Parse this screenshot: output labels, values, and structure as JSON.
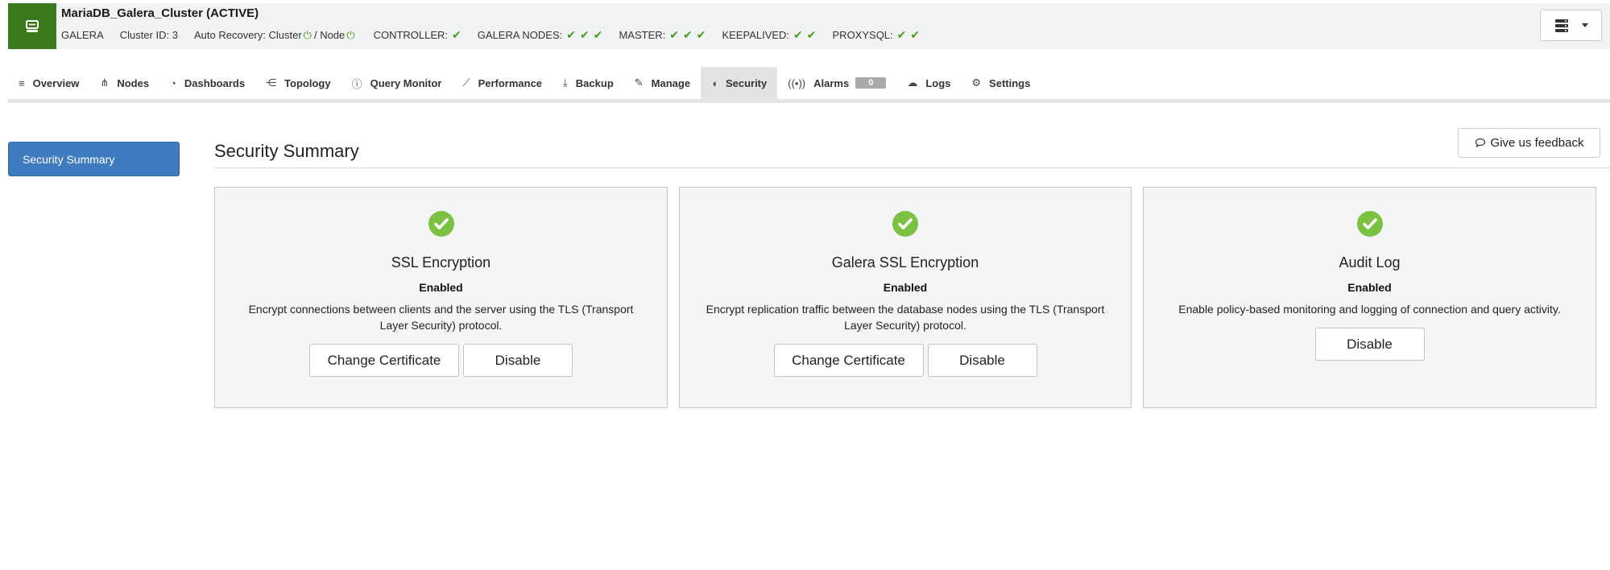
{
  "header": {
    "title": "MariaDB_Galera_Cluster (ACTIVE)",
    "type": "GALERA",
    "cluster_id": "Cluster ID: 3",
    "auto_recovery_label": "Auto Recovery: Cluster",
    "auto_recovery_node": "/ Node",
    "controller": "CONTROLLER:",
    "galera_nodes": "GALERA NODES:",
    "master": "MASTER:",
    "keepalived": "KEEPALIVED:",
    "proxysql": "PROXYSQL:",
    "check": "✔",
    "power": "⏻",
    "status_color": "#4a9c1f",
    "brand_color": "#3b7a1f"
  },
  "tabs": [
    {
      "label": "Overview",
      "icon": "list-icon",
      "glyph": "≡"
    },
    {
      "label": "Nodes",
      "icon": "nodes-icon",
      "glyph": "⋔"
    },
    {
      "label": "Dashboards",
      "icon": "dashboard-icon",
      "glyph": "◔"
    },
    {
      "label": "Topology",
      "icon": "topology-icon",
      "glyph": "⋲"
    },
    {
      "label": "Query Monitor",
      "icon": "query-monitor-icon",
      "glyph": "ⓘ"
    },
    {
      "label": "Performance",
      "icon": "performance-icon",
      "glyph": "⟋"
    },
    {
      "label": "Backup",
      "icon": "backup-icon",
      "glyph": "⤓"
    },
    {
      "label": "Manage",
      "icon": "wrench-icon",
      "glyph": "✎"
    },
    {
      "label": "Security",
      "icon": "shield-icon",
      "glyph": "◖"
    },
    {
      "label": "Alarms",
      "icon": "alarm-icon",
      "glyph": "((•))",
      "badge": "0"
    },
    {
      "label": "Logs",
      "icon": "logs-icon",
      "glyph": "☁"
    },
    {
      "label": "Settings",
      "icon": "gear-icon",
      "glyph": "⚙"
    }
  ],
  "sidebar": {
    "items": [
      {
        "label": "Security Summary"
      }
    ]
  },
  "main": {
    "title": "Security Summary",
    "feedback_label": "Give us feedback",
    "cards": [
      {
        "title": "SSL Encryption",
        "status": "Enabled",
        "description": "Encrypt connections between clients and the server using the TLS (Transport Layer Security) protocol.",
        "actions": [
          "Change Certificate",
          "Disable"
        ]
      },
      {
        "title": "Galera SSL Encryption",
        "status": "Enabled",
        "description": "Encrypt replication traffic between the database nodes using the TLS (Transport Layer Security) protocol.",
        "actions": [
          "Change Certificate",
          "Disable"
        ]
      },
      {
        "title": "Audit Log",
        "status": "Enabled",
        "description": "Enable policy-based monitoring and logging of connection and query activity.",
        "actions": [
          "Disable"
        ]
      }
    ]
  },
  "colors": {
    "accent_blue": "#3e7bbf",
    "ok_green": "#7cc242",
    "active_tab": "#e3e3e3"
  }
}
